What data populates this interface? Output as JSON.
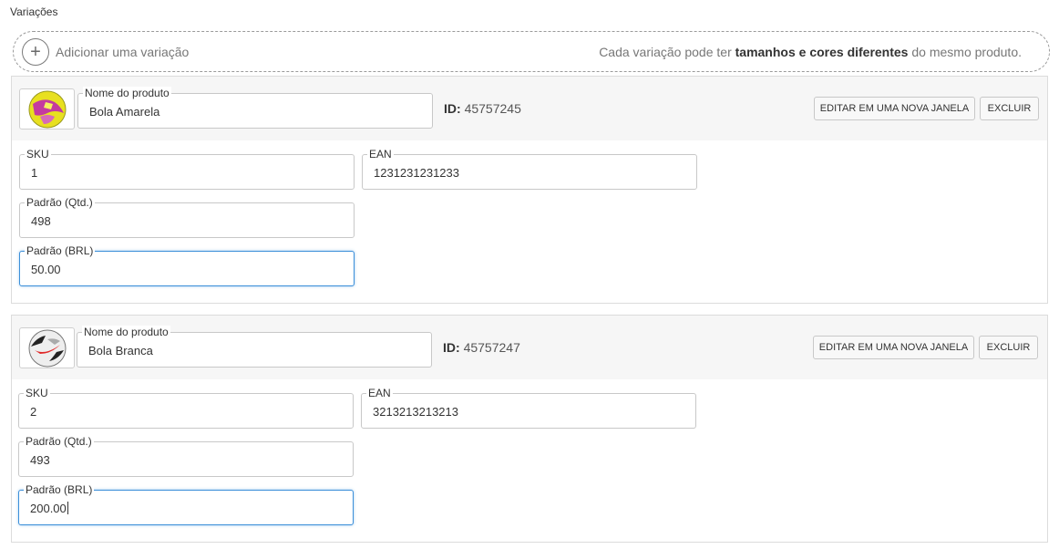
{
  "section": {
    "title": "Variações"
  },
  "add_bar": {
    "label": "Adicionar uma variação",
    "hint_pre": "Cada variação pode ter ",
    "hint_bold": "tamanhos e cores diferentes",
    "hint_post": " do mesmo produto."
  },
  "labels": {
    "name": "Nome do produto",
    "sku": "SKU",
    "ean": "EAN",
    "qty": "Padrão (Qtd.)",
    "price": "Padrão (BRL)",
    "id_prefix": "ID:",
    "edit_button": "EDITAR EM UMA NOVA JANELA",
    "delete_button": "EXCLUIR"
  },
  "variations": [
    {
      "name": "Bola Amarela",
      "id": "45757245",
      "sku": "1",
      "ean": "1231231231233",
      "qty": "498",
      "price": "50.00",
      "thumb_icon": "yellow-ball-icon"
    },
    {
      "name": "Bola Branca",
      "id": "45757247",
      "sku": "2",
      "ean": "3213213213213",
      "qty": "493",
      "price": "200.00",
      "thumb_icon": "white-ball-icon"
    }
  ],
  "colors": {
    "focus_border": "#3b8fd9",
    "header_bg": "#f6f6f6"
  }
}
